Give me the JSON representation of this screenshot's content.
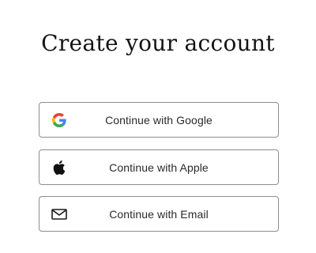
{
  "heading": "Create your account",
  "buttons": [
    {
      "label": "Continue with Google",
      "icon": "google-icon"
    },
    {
      "label": "Continue with Apple",
      "icon": "apple-icon"
    },
    {
      "label": "Continue with Email",
      "icon": "mail-icon"
    }
  ],
  "colors": {
    "google_blue": "#4285F4",
    "google_red": "#EA4335",
    "google_yellow": "#FBBC05",
    "google_green": "#34A853",
    "button_border": "#8e8e8e",
    "text": "#2a2a2a"
  }
}
